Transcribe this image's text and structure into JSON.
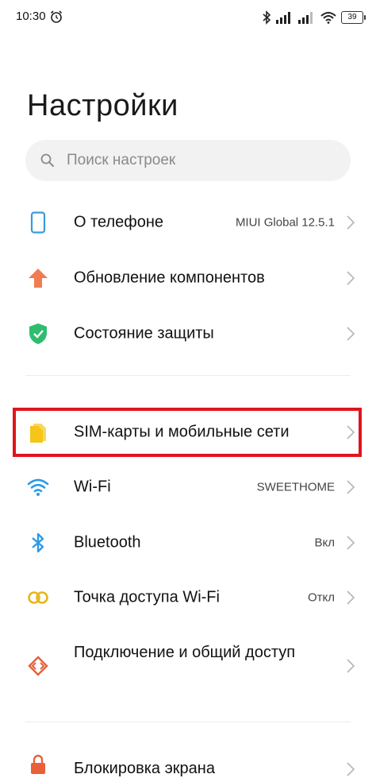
{
  "status_bar": {
    "time": "10:30",
    "battery": "39"
  },
  "page": {
    "title": "Настройки"
  },
  "search": {
    "placeholder": "Поиск настроек"
  },
  "items": [
    {
      "label": "О телефоне",
      "value": "MIUI Global 12.5.1",
      "icon": "phone-icon",
      "color": "#3a9ad9"
    },
    {
      "label": "Обновление компонентов",
      "value": "",
      "icon": "update-arrow-icon",
      "color": "#f07c52"
    },
    {
      "label": "Состояние защиты",
      "value": "",
      "icon": "shield-check-icon",
      "color": "#2ebd6f"
    },
    {
      "label": "SIM-карты и мобильные сети",
      "value": "",
      "icon": "sim-card-icon",
      "color": "#f5c518"
    },
    {
      "label": "Wi-Fi",
      "value": "SWEETHOME",
      "icon": "wifi-icon",
      "color": "#2d9ae8"
    },
    {
      "label": "Bluetooth",
      "value": "Вкл",
      "icon": "bluetooth-icon",
      "color": "#2d9ae8"
    },
    {
      "label": "Точка доступа Wi-Fi",
      "value": "Откл",
      "icon": "hotspot-icon",
      "color": "#e6b818"
    },
    {
      "label": "Подключение и общий доступ",
      "value": "",
      "icon": "connection-share-icon",
      "color": "#e8613a"
    },
    {
      "label": "Блокировка экрана",
      "value": "",
      "icon": "lock-icon",
      "color": "#e8613a"
    }
  ],
  "highlight_color": "#e0141c"
}
